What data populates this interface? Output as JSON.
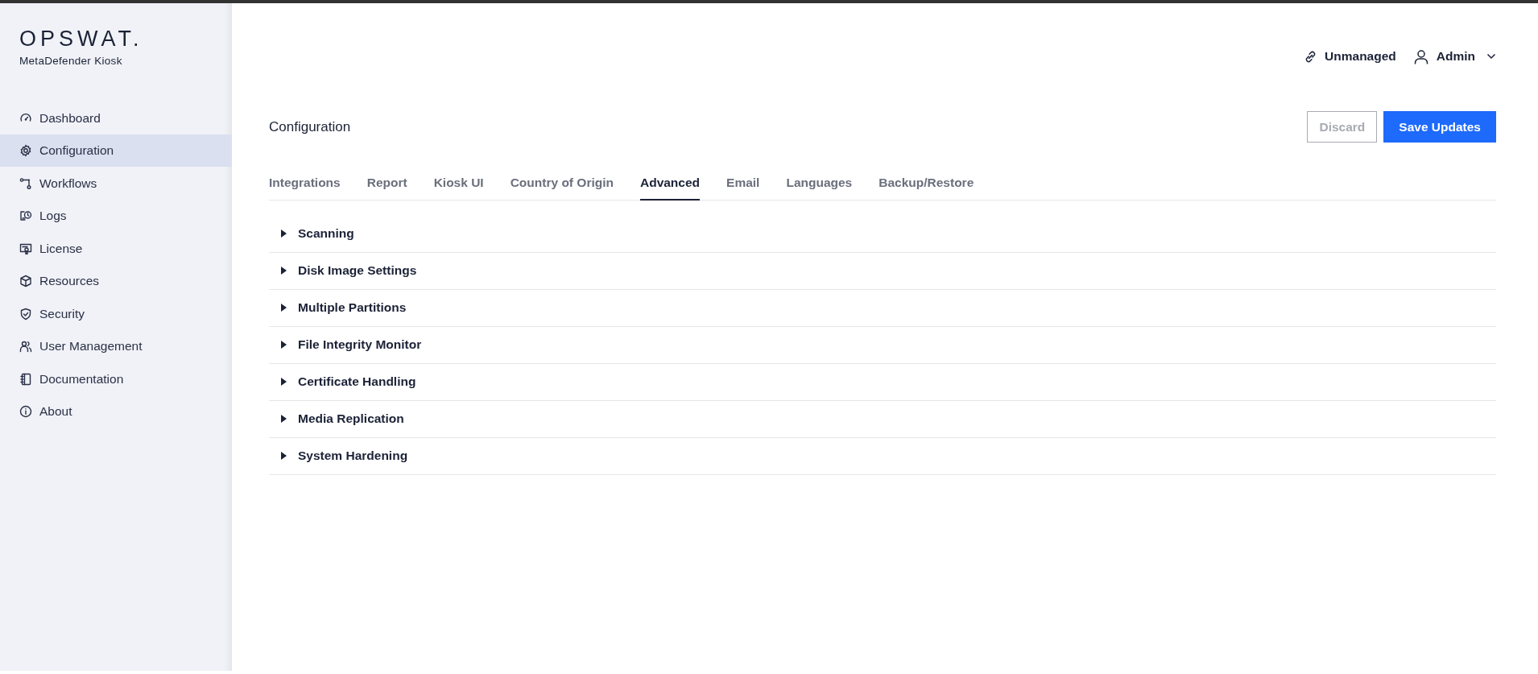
{
  "brand": {
    "logo": "OPSWAT.",
    "product": "MetaDefender Kiosk"
  },
  "sidebar": {
    "items": [
      {
        "label": "Dashboard",
        "selected": false
      },
      {
        "label": "Configuration",
        "selected": true
      },
      {
        "label": "Workflows",
        "selected": false
      },
      {
        "label": "Logs",
        "selected": false
      },
      {
        "label": "License",
        "selected": false
      },
      {
        "label": "Resources",
        "selected": false
      },
      {
        "label": "Security",
        "selected": false
      },
      {
        "label": "User Management",
        "selected": false
      },
      {
        "label": "Documentation",
        "selected": false
      },
      {
        "label": "About",
        "selected": false
      }
    ]
  },
  "header": {
    "status": "Unmanaged",
    "user": "Admin"
  },
  "page": {
    "title": "Configuration",
    "buttons": [
      {
        "label": "Discard",
        "kind": "secondary",
        "disabled": true
      },
      {
        "label": "Save Updates",
        "kind": "primary",
        "disabled": false
      }
    ]
  },
  "tabs": [
    {
      "label": "Integrations",
      "selected": false
    },
    {
      "label": "Report",
      "selected": false
    },
    {
      "label": "Kiosk UI",
      "selected": false
    },
    {
      "label": "Country of Origin",
      "selected": false
    },
    {
      "label": "Advanced",
      "selected": true
    },
    {
      "label": "Email",
      "selected": false
    },
    {
      "label": "Languages",
      "selected": false
    },
    {
      "label": "Backup/Restore",
      "selected": false
    }
  ],
  "sections": [
    {
      "label": "Scanning",
      "expanded": false
    },
    {
      "label": "Disk Image Settings",
      "expanded": false
    },
    {
      "label": "Multiple Partitions",
      "expanded": false
    },
    {
      "label": "File Integrity Monitor",
      "expanded": false
    },
    {
      "label": "Certificate Handling",
      "expanded": false
    },
    {
      "label": "Media Replication",
      "expanded": false
    },
    {
      "label": "System Hardening",
      "expanded": false
    }
  ]
}
